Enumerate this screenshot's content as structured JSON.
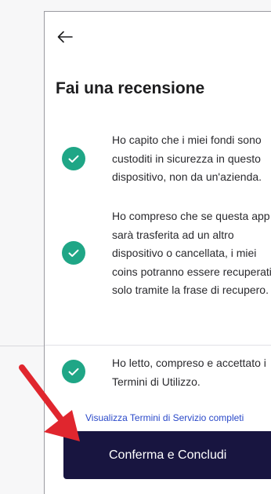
{
  "header": {
    "back_icon": "arrow-left-icon",
    "title": "Fai una recensione"
  },
  "checklist": [
    {
      "lines": [
        "Ho capito che i miei fondi sono",
        "custoditi in sicurezza in questo",
        "dispositivo, non da un'azienda."
      ],
      "checked": true
    },
    {
      "lines": [
        "Ho compreso che se questa app",
        "sarà trasferita ad un altro",
        "dispositivo o cancellata, i miei",
        "coins potranno essere recuperati",
        "solo tramite la frase di recupero."
      ],
      "checked": true
    },
    {
      "lines": [
        "Ho letto, compreso e accettato i",
        "Termini di Utilizzo."
      ],
      "checked": true
    }
  ],
  "terms_link": "Visualizza Termini di Servizio completi",
  "confirm_button": "Conferma e Concludi",
  "colors": {
    "check": "#1fa686",
    "button": "#181540",
    "link": "#2a49c9",
    "annotation_arrow": "#e0262e"
  }
}
